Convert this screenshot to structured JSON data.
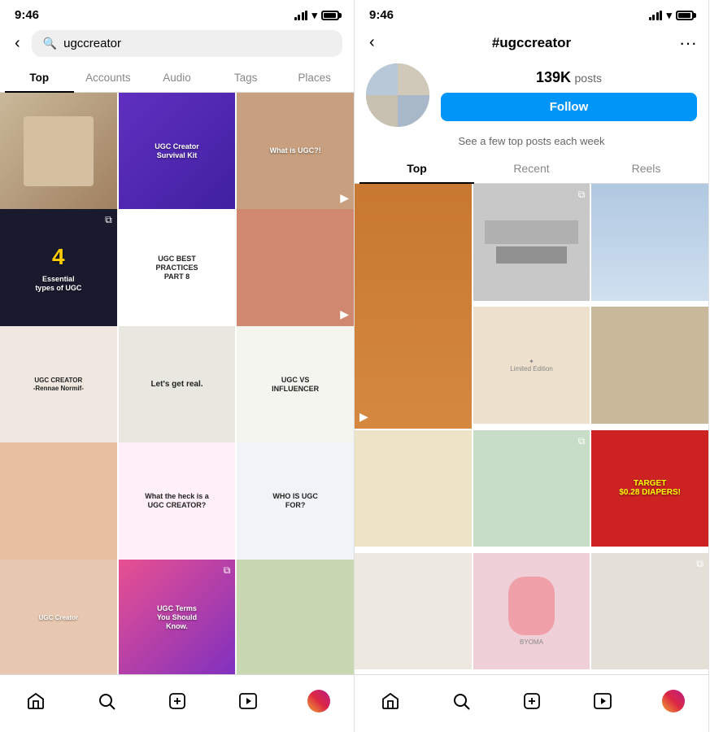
{
  "left": {
    "status_time": "9:46",
    "search_placeholder": "ugccreator",
    "tabs": [
      "Top",
      "Accounts",
      "Audio",
      "Tags",
      "Places"
    ],
    "active_tab": "Top",
    "grid_cells": [
      {
        "color": "c1",
        "label": "",
        "type": "image"
      },
      {
        "color": "c2",
        "label": "UGC Creator Survival Kit",
        "type": "image"
      },
      {
        "color": "c6",
        "label": "What is UGC?!",
        "type": "image"
      },
      {
        "color": "c4",
        "label": "4 Essential types of UGC",
        "type": "image"
      },
      {
        "color": "c5",
        "label": "UGC BEST PRACTICES PART 8",
        "type": "image"
      },
      {
        "color": "c6",
        "label": "",
        "type": "video"
      },
      {
        "color": "c14",
        "label": "UGC CREATOR",
        "type": "image"
      },
      {
        "color": "c5",
        "label": "Let's get real",
        "type": "image"
      },
      {
        "color": "c5",
        "label": "UGC VS INFLUENCER",
        "type": "image"
      },
      {
        "color": "c6",
        "label": "",
        "type": "image"
      },
      {
        "color": "c5",
        "label": "What the heck is a UGC CREATOR?",
        "type": "image"
      },
      {
        "color": "c5",
        "label": "WHO IS UGC FOR?",
        "type": "image"
      },
      {
        "color": "c6",
        "label": "",
        "type": "image"
      },
      {
        "color": "c18",
        "label": "UGC Terms You Should Know",
        "type": "image"
      },
      {
        "color": "c7",
        "label": "",
        "type": "image"
      }
    ],
    "nav": {
      "home": "⌂",
      "search": "🔍",
      "add": "+",
      "reels": "▶",
      "profile": ""
    }
  },
  "right": {
    "status_time": "9:46",
    "title": "#ugccreator",
    "posts_count": "139K",
    "posts_label": "posts",
    "follow_label": "Follow",
    "see_top_text": "See a few top posts each week",
    "tabs": [
      "Top",
      "Recent",
      "Reels"
    ],
    "active_tab": "Top",
    "grid_cells": [
      {
        "color": "c13",
        "label": "",
        "type": "reels"
      },
      {
        "color": "c5",
        "label": "",
        "type": "multi"
      },
      {
        "color": "c15",
        "label": "",
        "type": "image"
      },
      {
        "color": "c16",
        "label": "",
        "type": "image"
      },
      {
        "color": "c1",
        "label": "",
        "type": "image"
      },
      {
        "color": "c9",
        "label": "",
        "type": "image"
      },
      {
        "color": "c10",
        "label": "",
        "type": "image"
      },
      {
        "color": "c11",
        "label": "TARGET $0.28 DIAPERS!",
        "type": "image"
      },
      {
        "color": "c17",
        "label": "",
        "type": "image"
      },
      {
        "color": "c20",
        "label": "",
        "type": "image"
      },
      {
        "color": "c5",
        "label": "",
        "type": "image"
      }
    ],
    "nav": {
      "home": "⌂",
      "search": "🔍",
      "add": "+",
      "reels": "▶",
      "profile": ""
    }
  }
}
